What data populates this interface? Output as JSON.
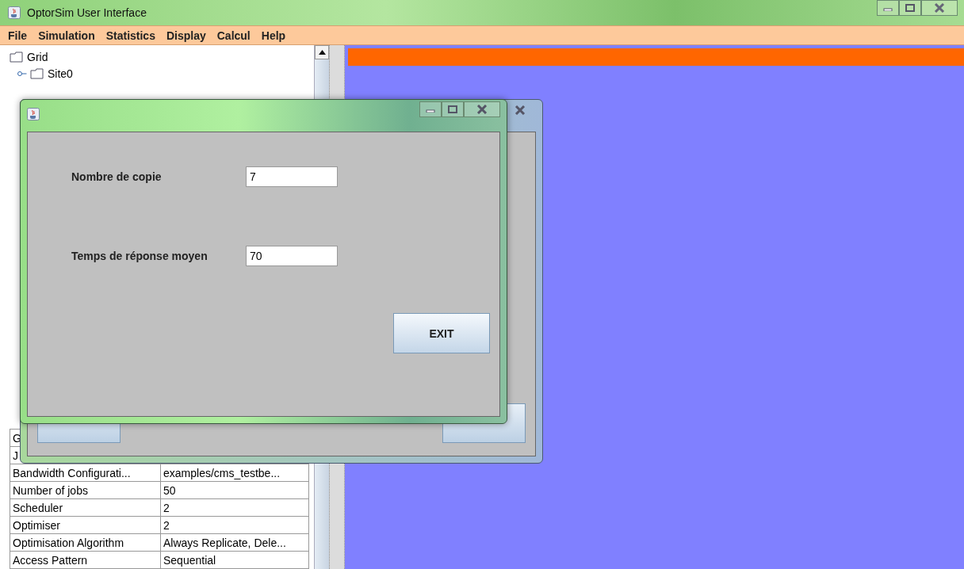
{
  "window": {
    "title": "OptorSim User Interface"
  },
  "menu": [
    {
      "label": "File"
    },
    {
      "label": "Simulation"
    },
    {
      "label": "Statistics"
    },
    {
      "label": "Display"
    },
    {
      "label": "Calcul"
    },
    {
      "label": "Help"
    }
  ],
  "tree": [
    {
      "label": "Grid",
      "children": [
        {
          "label": "Site0",
          "expanded": false
        }
      ]
    }
  ],
  "table": {
    "rows": [
      {
        "name": "G"
      },
      {
        "name": "J"
      },
      {
        "name": "Bandwidth Configurati...",
        "value": "examples/cms_testbe..."
      },
      {
        "name": "Number of jobs",
        "value": "50"
      },
      {
        "name": "Scheduler",
        "value": "2"
      },
      {
        "name": "Optimiser",
        "value": "2"
      },
      {
        "name": "Optimisation Algorithm",
        "value": "Always Replicate, Dele..."
      },
      {
        "name": "Access Pattern",
        "value": "Sequential"
      }
    ]
  },
  "dialog": {
    "fields": [
      {
        "label": "Nombre de copie",
        "value": "7"
      },
      {
        "label": "Temps de réponse moyen",
        "value": "70"
      }
    ],
    "button": "EXIT"
  }
}
